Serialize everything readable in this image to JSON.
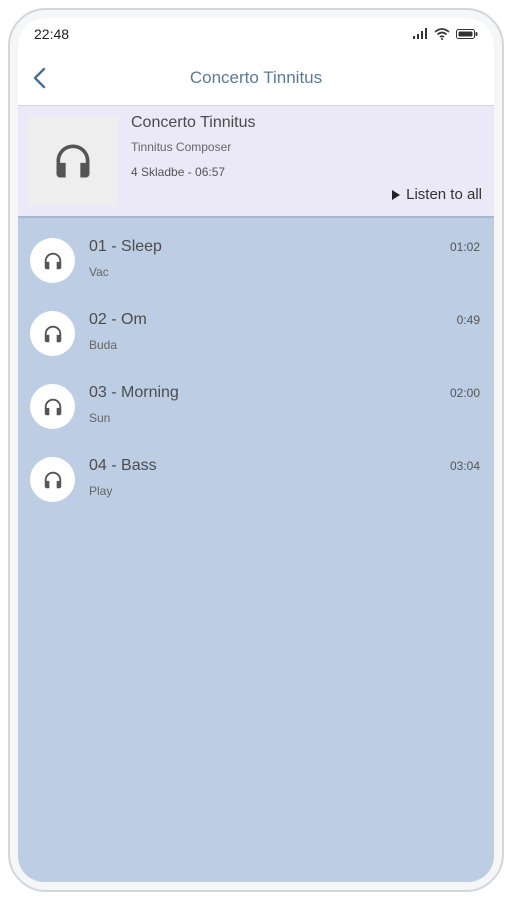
{
  "status_bar": {
    "time": "22:48"
  },
  "header": {
    "title": "Concerto Tinnitus"
  },
  "album": {
    "title": "Concerto Tinnitus",
    "artist": "Tinnitus Composer",
    "meta": "4 Skladbe - 06:57",
    "listen_all_label": "Listen to all",
    "cover_icon": "headphones-icon"
  },
  "tracks": [
    {
      "title": "01 - Sleep",
      "subtitle": "Vac",
      "duration": "01:02",
      "icon": "headphones-icon"
    },
    {
      "title": "02 - Om",
      "subtitle": "Buda",
      "duration": "0:49",
      "icon": "headphones-icon"
    },
    {
      "title": "03 - Morning",
      "subtitle": "Sun",
      "duration": "02:00",
      "icon": "headphones-icon"
    },
    {
      "title": "04 - Bass",
      "subtitle": "Play",
      "duration": "03:04",
      "icon": "headphones-icon"
    }
  ],
  "colors": {
    "list_background": "#bccde4",
    "album_background": "#ebe8f7",
    "header_title": "#5b7a99"
  }
}
